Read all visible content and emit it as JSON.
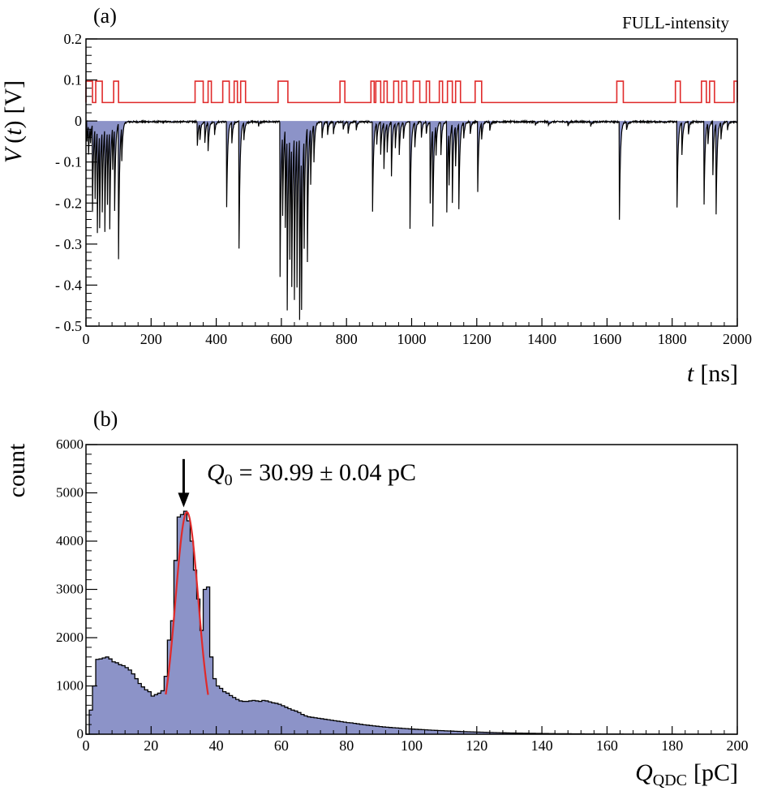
{
  "chart_data": [
    {
      "type": "line",
      "panel_label": "(a)",
      "corner_label": "FULL-intensity",
      "xlabel": {
        "symbol": "t",
        "unit": "[ns]"
      },
      "ylabel": {
        "symbol": "V",
        "arg": "(t)",
        "unit": "[V]"
      },
      "xlim": [
        0,
        2000
      ],
      "ylim": [
        -0.5,
        0.2
      ],
      "xticks": [
        0,
        200,
        400,
        600,
        800,
        1000,
        1200,
        1400,
        1600,
        1800,
        2000
      ],
      "xtick_labels": [
        "0",
        "200",
        "400",
        "600",
        "800",
        "1000",
        "1200",
        "1400",
        "1600",
        "1800",
        "2000"
      ],
      "yticks": [
        0.2,
        0.1,
        0,
        -0.1,
        -0.2,
        -0.3,
        -0.4,
        -0.5
      ],
      "ytick_labels": [
        "0.2",
        "0.1",
        "0",
        "- 0.1",
        "- 0.2",
        "- 0.3",
        "- 0.4",
        "- 0.5"
      ],
      "colors": {
        "waveform_fill": "#8c93c8",
        "waveform_line": "#000000",
        "gate_line": "#e02a2a"
      },
      "series": [
        {
          "kind": "gate",
          "low": 0.045,
          "high": 0.097,
          "intervals": [
            [
              0,
              20
            ],
            [
              30,
              50
            ],
            [
              85,
              100
            ],
            [
              335,
              360
            ],
            [
              375,
              385
            ],
            [
              420,
              440
            ],
            [
              455,
              465
            ],
            [
              475,
              490
            ],
            [
              590,
              620
            ],
            [
              780,
              795
            ],
            [
              875,
              885
            ],
            [
              890,
              905
            ],
            [
              915,
              925
            ],
            [
              945,
              960
            ],
            [
              970,
              985
            ],
            [
              1005,
              1025
            ],
            [
              1045,
              1055
            ],
            [
              1085,
              1095
            ],
            [
              1110,
              1125
            ],
            [
              1135,
              1150
            ],
            [
              1195,
              1215
            ],
            [
              1630,
              1650
            ],
            [
              1810,
              1825
            ],
            [
              1890,
              1905
            ],
            [
              1915,
              1930
            ],
            [
              1990,
              2000
            ]
          ]
        },
        {
          "kind": "waveform",
          "baseline": -0.002,
          "pulses": [
            [
              3,
              -0.05
            ],
            [
              8,
              -0.07
            ],
            [
              14,
              -0.04
            ],
            [
              20,
              -0.21
            ],
            [
              28,
              -0.17
            ],
            [
              35,
              -0.25
            ],
            [
              42,
              -0.23
            ],
            [
              50,
              -0.2
            ],
            [
              58,
              -0.25
            ],
            [
              66,
              -0.18
            ],
            [
              73,
              -0.24
            ],
            [
              82,
              -0.1
            ],
            [
              88,
              -0.2
            ],
            [
              100,
              -0.33
            ],
            [
              110,
              -0.08
            ],
            [
              342,
              -0.06
            ],
            [
              350,
              -0.04
            ],
            [
              365,
              -0.05
            ],
            [
              375,
              -0.07
            ],
            [
              395,
              -0.03
            ],
            [
              432,
              -0.21
            ],
            [
              448,
              -0.05
            ],
            [
              470,
              -0.31
            ],
            [
              485,
              -0.04
            ],
            [
              530,
              -0.01
            ],
            [
              596,
              -0.38
            ],
            [
              604,
              -0.2
            ],
            [
              612,
              -0.24
            ],
            [
              618,
              -0.42
            ],
            [
              626,
              -0.3
            ],
            [
              632,
              -0.35
            ],
            [
              640,
              -0.4
            ],
            [
              648,
              -0.37
            ],
            [
              656,
              -0.48
            ],
            [
              662,
              -0.38
            ],
            [
              670,
              -0.27
            ],
            [
              680,
              -0.33
            ],
            [
              690,
              -0.14
            ],
            [
              700,
              -0.09
            ],
            [
              725,
              -0.04
            ],
            [
              742,
              -0.03
            ],
            [
              760,
              -0.03
            ],
            [
              790,
              -0.02
            ],
            [
              805,
              -0.03
            ],
            [
              830,
              -0.02
            ],
            [
              880,
              -0.22
            ],
            [
              893,
              -0.05
            ],
            [
              905,
              -0.08
            ],
            [
              915,
              -0.11
            ],
            [
              925,
              -0.07
            ],
            [
              938,
              -0.13
            ],
            [
              950,
              -0.06
            ],
            [
              962,
              -0.08
            ],
            [
              975,
              -0.04
            ],
            [
              995,
              -0.26
            ],
            [
              1010,
              -0.06
            ],
            [
              1030,
              -0.04
            ],
            [
              1045,
              -0.03
            ],
            [
              1057,
              -0.2
            ],
            [
              1065,
              -0.24
            ],
            [
              1075,
              -0.07
            ],
            [
              1090,
              -0.08
            ],
            [
              1108,
              -0.22
            ],
            [
              1115,
              -0.13
            ],
            [
              1125,
              -0.19
            ],
            [
              1135,
              -0.1
            ],
            [
              1145,
              -0.21
            ],
            [
              1160,
              -0.04
            ],
            [
              1180,
              -0.03
            ],
            [
              1203,
              -0.17
            ],
            [
              1215,
              -0.04
            ],
            [
              1240,
              -0.02
            ],
            [
              1380,
              -0.01
            ],
            [
              1420,
              -0.01
            ],
            [
              1480,
              -0.01
            ],
            [
              1550,
              -0.01
            ],
            [
              1638,
              -0.24
            ],
            [
              1660,
              -0.02
            ],
            [
              1815,
              -0.21
            ],
            [
              1830,
              -0.08
            ],
            [
              1850,
              -0.03
            ],
            [
              1898,
              -0.2
            ],
            [
              1910,
              -0.05
            ],
            [
              1925,
              -0.13
            ],
            [
              1935,
              -0.22
            ],
            [
              1950,
              -0.04
            ],
            [
              1970,
              -0.02
            ]
          ]
        }
      ]
    },
    {
      "type": "bar",
      "panel_label": "(b)",
      "xlabel": {
        "symbol": "Q",
        "sub": "QDC",
        "unit": "[pC]"
      },
      "ylabel": "count",
      "xlim": [
        0,
        200
      ],
      "ylim": [
        0,
        6000
      ],
      "xticks": [
        0,
        20,
        40,
        60,
        80,
        100,
        120,
        140,
        160,
        180,
        200
      ],
      "xtick_labels": [
        "0",
        "20",
        "40",
        "60",
        "80",
        "100",
        "120",
        "140",
        "160",
        "180",
        "200"
      ],
      "yticks": [
        0,
        1000,
        2000,
        3000,
        4000,
        5000,
        6000
      ],
      "ytick_labels": [
        "0",
        "1000",
        "2000",
        "3000",
        "4000",
        "5000",
        "6000"
      ],
      "annotation": {
        "symbol": "Q",
        "sub": "0",
        "text": "= 30.99 ± 0.04 pC",
        "arrow_x": 30,
        "arrow_from": 5700,
        "arrow_to": 4700
      },
      "fit": {
        "kind": "gaussian",
        "mean": 30.99,
        "sigma": 3.5,
        "amplitude": 4600,
        "range": [
          24.5,
          37.5
        ]
      },
      "colors": {
        "hist_fill": "#8c93c8",
        "hist_line": "#000000",
        "fit_line": "#e02a2a"
      },
      "bin_width": 1,
      "x_start": 0,
      "values": [
        0,
        500,
        1000,
        1550,
        1560,
        1580,
        1600,
        1560,
        1500,
        1480,
        1440,
        1420,
        1380,
        1330,
        1250,
        1150,
        1050,
        980,
        920,
        880,
        790,
        820,
        850,
        900,
        1200,
        1950,
        2350,
        3600,
        4500,
        4550,
        4620,
        4420,
        4000,
        3400,
        2800,
        2150,
        3000,
        3050,
        1600,
        1150,
        1000,
        950,
        880,
        850,
        800,
        760,
        720,
        690,
        680,
        680,
        690,
        700,
        690,
        680,
        700,
        690,
        670,
        650,
        640,
        620,
        590,
        560,
        530,
        500,
        480,
        450,
        410,
        380,
        360,
        350,
        340,
        330,
        320,
        310,
        300,
        290,
        280,
        270,
        260,
        250,
        240,
        235,
        225,
        215,
        205,
        195,
        188,
        180,
        172,
        165,
        158,
        150,
        145,
        140,
        135,
        130,
        125,
        120,
        115,
        110,
        106,
        102,
        98,
        94,
        90,
        86,
        82,
        79,
        76,
        73,
        70,
        67,
        64,
        61,
        58,
        55,
        52,
        50,
        48,
        46,
        44,
        42,
        40,
        38,
        36,
        34,
        32,
        30,
        28,
        26,
        25,
        24,
        23,
        22,
        21,
        20,
        19,
        18,
        17,
        16,
        15,
        14,
        13,
        12,
        11,
        10,
        10,
        9,
        9,
        8,
        8,
        7,
        7,
        6,
        6,
        5,
        5,
        5,
        4,
        4,
        4,
        3,
        3,
        3,
        3,
        2,
        2,
        2,
        2,
        2,
        2,
        1,
        1,
        1,
        1,
        1,
        1,
        1,
        1,
        1,
        1,
        0,
        0,
        0,
        0,
        0,
        0,
        0,
        0,
        0,
        0,
        0,
        0,
        0,
        0,
        0,
        0,
        0,
        0,
        0
      ]
    }
  ]
}
